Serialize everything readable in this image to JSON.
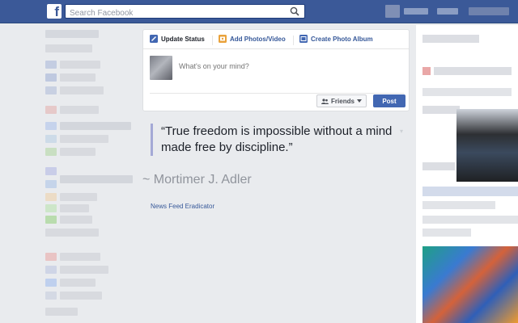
{
  "search": {
    "placeholder": "Search Facebook"
  },
  "composer": {
    "tabs": [
      {
        "label": "Update Status",
        "icon": "pencil-icon"
      },
      {
        "label": "Add Photos/Video",
        "icon": "photo-icon"
      },
      {
        "label": "Create Photo Album",
        "icon": "album-icon"
      }
    ],
    "placeholder": "What's on your mind?",
    "audience_label": "Friends",
    "post_label": "Post"
  },
  "quote": {
    "text": "“True freedom is impossible without a mind made free by discipline.”",
    "author": "~ Mortimer J. Adler"
  },
  "link": {
    "label": "News Feed Eradicator"
  },
  "colors": {
    "topbar": "#3b5998",
    "accent": "#4267b2",
    "quote_bar": "#a4a9d6",
    "background": "#e9ebee"
  }
}
